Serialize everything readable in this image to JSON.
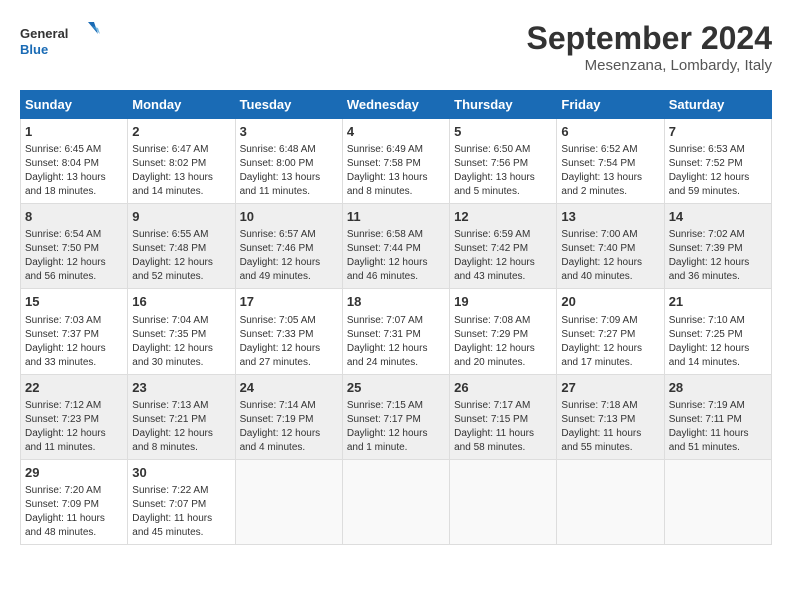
{
  "header": {
    "logo_general": "General",
    "logo_blue": "Blue",
    "month_title": "September 2024",
    "location": "Mesenzana, Lombardy, Italy"
  },
  "weekdays": [
    "Sunday",
    "Monday",
    "Tuesday",
    "Wednesday",
    "Thursday",
    "Friday",
    "Saturday"
  ],
  "weeks": [
    [
      {
        "day": "1",
        "sunrise": "6:45 AM",
        "sunset": "8:04 PM",
        "daylight": "13 hours and 18 minutes."
      },
      {
        "day": "2",
        "sunrise": "6:47 AM",
        "sunset": "8:02 PM",
        "daylight": "13 hours and 14 minutes."
      },
      {
        "day": "3",
        "sunrise": "6:48 AM",
        "sunset": "8:00 PM",
        "daylight": "13 hours and 11 minutes."
      },
      {
        "day": "4",
        "sunrise": "6:49 AM",
        "sunset": "7:58 PM",
        "daylight": "13 hours and 8 minutes."
      },
      {
        "day": "5",
        "sunrise": "6:50 AM",
        "sunset": "7:56 PM",
        "daylight": "13 hours and 5 minutes."
      },
      {
        "day": "6",
        "sunrise": "6:52 AM",
        "sunset": "7:54 PM",
        "daylight": "13 hours and 2 minutes."
      },
      {
        "day": "7",
        "sunrise": "6:53 AM",
        "sunset": "7:52 PM",
        "daylight": "12 hours and 59 minutes."
      }
    ],
    [
      {
        "day": "8",
        "sunrise": "6:54 AM",
        "sunset": "7:50 PM",
        "daylight": "12 hours and 56 minutes."
      },
      {
        "day": "9",
        "sunrise": "6:55 AM",
        "sunset": "7:48 PM",
        "daylight": "12 hours and 52 minutes."
      },
      {
        "day": "10",
        "sunrise": "6:57 AM",
        "sunset": "7:46 PM",
        "daylight": "12 hours and 49 minutes."
      },
      {
        "day": "11",
        "sunrise": "6:58 AM",
        "sunset": "7:44 PM",
        "daylight": "12 hours and 46 minutes."
      },
      {
        "day": "12",
        "sunrise": "6:59 AM",
        "sunset": "7:42 PM",
        "daylight": "12 hours and 43 minutes."
      },
      {
        "day": "13",
        "sunrise": "7:00 AM",
        "sunset": "7:40 PM",
        "daylight": "12 hours and 40 minutes."
      },
      {
        "day": "14",
        "sunrise": "7:02 AM",
        "sunset": "7:39 PM",
        "daylight": "12 hours and 36 minutes."
      }
    ],
    [
      {
        "day": "15",
        "sunrise": "7:03 AM",
        "sunset": "7:37 PM",
        "daylight": "12 hours and 33 minutes."
      },
      {
        "day": "16",
        "sunrise": "7:04 AM",
        "sunset": "7:35 PM",
        "daylight": "12 hours and 30 minutes."
      },
      {
        "day": "17",
        "sunrise": "7:05 AM",
        "sunset": "7:33 PM",
        "daylight": "12 hours and 27 minutes."
      },
      {
        "day": "18",
        "sunrise": "7:07 AM",
        "sunset": "7:31 PM",
        "daylight": "12 hours and 24 minutes."
      },
      {
        "day": "19",
        "sunrise": "7:08 AM",
        "sunset": "7:29 PM",
        "daylight": "12 hours and 20 minutes."
      },
      {
        "day": "20",
        "sunrise": "7:09 AM",
        "sunset": "7:27 PM",
        "daylight": "12 hours and 17 minutes."
      },
      {
        "day": "21",
        "sunrise": "7:10 AM",
        "sunset": "7:25 PM",
        "daylight": "12 hours and 14 minutes."
      }
    ],
    [
      {
        "day": "22",
        "sunrise": "7:12 AM",
        "sunset": "7:23 PM",
        "daylight": "12 hours and 11 minutes."
      },
      {
        "day": "23",
        "sunrise": "7:13 AM",
        "sunset": "7:21 PM",
        "daylight": "12 hours and 8 minutes."
      },
      {
        "day": "24",
        "sunrise": "7:14 AM",
        "sunset": "7:19 PM",
        "daylight": "12 hours and 4 minutes."
      },
      {
        "day": "25",
        "sunrise": "7:15 AM",
        "sunset": "7:17 PM",
        "daylight": "12 hours and 1 minute."
      },
      {
        "day": "26",
        "sunrise": "7:17 AM",
        "sunset": "7:15 PM",
        "daylight": "11 hours and 58 minutes."
      },
      {
        "day": "27",
        "sunrise": "7:18 AM",
        "sunset": "7:13 PM",
        "daylight": "11 hours and 55 minutes."
      },
      {
        "day": "28",
        "sunrise": "7:19 AM",
        "sunset": "7:11 PM",
        "daylight": "11 hours and 51 minutes."
      }
    ],
    [
      {
        "day": "29",
        "sunrise": "7:20 AM",
        "sunset": "7:09 PM",
        "daylight": "11 hours and 48 minutes."
      },
      {
        "day": "30",
        "sunrise": "7:22 AM",
        "sunset": "7:07 PM",
        "daylight": "11 hours and 45 minutes."
      },
      null,
      null,
      null,
      null,
      null
    ]
  ]
}
